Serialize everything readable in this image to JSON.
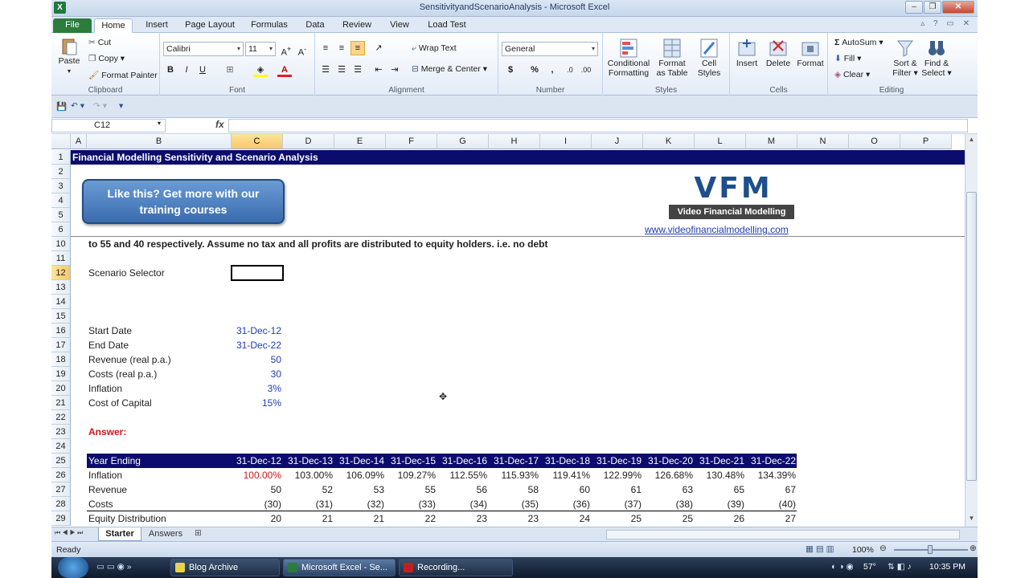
{
  "app": {
    "title": "SensitivityandScenarioAnalysis - Microsoft Excel"
  },
  "tabs": [
    "File",
    "Home",
    "Insert",
    "Page Layout",
    "Formulas",
    "Data",
    "Review",
    "View",
    "Load Test"
  ],
  "ribbon": {
    "clipboard": {
      "paste": "Paste",
      "cut": "Cut",
      "copy": "Copy",
      "format_painter": "Format Painter",
      "label": "Clipboard"
    },
    "font": {
      "name": "Calibri",
      "size": "11",
      "bold": "B",
      "italic": "I",
      "underline": "U",
      "label": "Font"
    },
    "alignment": {
      "wrap": "Wrap Text",
      "merge": "Merge & Center",
      "label": "Alignment"
    },
    "number": {
      "format": "General",
      "currency": "$",
      "percent": "%",
      "comma": ",",
      "label": "Number"
    },
    "styles": {
      "conditional": "Conditional",
      "conditional2": "Formatting",
      "format_table": "Format",
      "format_table2": "as Table",
      "cell_styles": "Cell",
      "cell_styles2": "Styles",
      "label": "Styles"
    },
    "cells": {
      "insert": "Insert",
      "delete": "Delete",
      "format": "Format",
      "label": "Cells"
    },
    "editing": {
      "autosum": "AutoSum",
      "fill": "Fill",
      "clear": "Clear",
      "sort": "Sort &",
      "sort2": "Filter",
      "find": "Find &",
      "find2": "Select",
      "label": "Editing"
    }
  },
  "formula_bar": {
    "name_box": "C12",
    "fx": "fx",
    "formula": ""
  },
  "columns": [
    "A",
    "B",
    "C",
    "D",
    "E",
    "F",
    "G",
    "H",
    "I",
    "J",
    "K",
    "L",
    "M",
    "N",
    "O",
    "P"
  ],
  "rows": [
    "1",
    "2",
    "3",
    "4",
    "5",
    "6",
    "10",
    "11",
    "12",
    "13",
    "14",
    "15",
    "16",
    "17",
    "18",
    "19",
    "20",
    "21",
    "22",
    "23",
    "24",
    "25",
    "26",
    "27",
    "28",
    "29"
  ],
  "sheet": {
    "header": "Financial Modelling Sensitivity and Scenario Analysis",
    "button": {
      "line1": "Like this? Get more with our",
      "line2": "training courses"
    },
    "logo": {
      "mark": "VFM",
      "caption": "Video Financial Modelling",
      "url": "www.videofinancialmodelling.com"
    },
    "row10": "to 55 and 40 respectively. Assume no tax and all profits are distributed to equity holders. i.e. no debt",
    "scenario_label": "Scenario Selector",
    "inputs": [
      {
        "label": "Start Date",
        "value": "31-Dec-12"
      },
      {
        "label": "End Date",
        "value": "31-Dec-22"
      },
      {
        "label": "Revenue (real p.a.)",
        "value": "50"
      },
      {
        "label": "Costs (real p.a.)",
        "value": "30"
      },
      {
        "label": "Inflation",
        "value": "3%"
      },
      {
        "label": "Cost of Capital",
        "value": "15%"
      }
    ],
    "answer": "Answer:",
    "table": {
      "header_label": "Year Ending",
      "years": [
        "31-Dec-12",
        "31-Dec-13",
        "31-Dec-14",
        "31-Dec-15",
        "31-Dec-16",
        "31-Dec-17",
        "31-Dec-18",
        "31-Dec-19",
        "31-Dec-20",
        "31-Dec-21",
        "31-Dec-22"
      ],
      "rows": [
        {
          "label": "Inflation",
          "values": [
            "100.00%",
            "103.00%",
            "106.09%",
            "109.27%",
            "112.55%",
            "115.93%",
            "119.41%",
            "122.99%",
            "126.68%",
            "130.48%",
            "134.39%"
          ]
        },
        {
          "label": "Revenue",
          "values": [
            "50",
            "52",
            "53",
            "55",
            "56",
            "58",
            "60",
            "61",
            "63",
            "65",
            "67"
          ]
        },
        {
          "label": "Costs",
          "values": [
            "(30)",
            "(31)",
            "(32)",
            "(33)",
            "(34)",
            "(35)",
            "(36)",
            "(37)",
            "(38)",
            "(39)",
            "(40)"
          ]
        },
        {
          "label": "Equity Distribution",
          "values": [
            "20",
            "21",
            "21",
            "22",
            "23",
            "23",
            "24",
            "25",
            "25",
            "26",
            "27"
          ]
        }
      ]
    }
  },
  "sheets": [
    "Starter",
    "Answers"
  ],
  "status": {
    "ready": "Ready",
    "zoom": "100%"
  },
  "taskbar": {
    "items": [
      "Blog Archive",
      "Microsoft Excel - Se...",
      "Recording..."
    ],
    "clock": "10:35 PM",
    "temp": "57°"
  },
  "colors": {
    "accent": "#0c0c6e",
    "excel_green": "#2c7c3c",
    "red": "#d01818",
    "blue_input": "#1f3bb5"
  }
}
